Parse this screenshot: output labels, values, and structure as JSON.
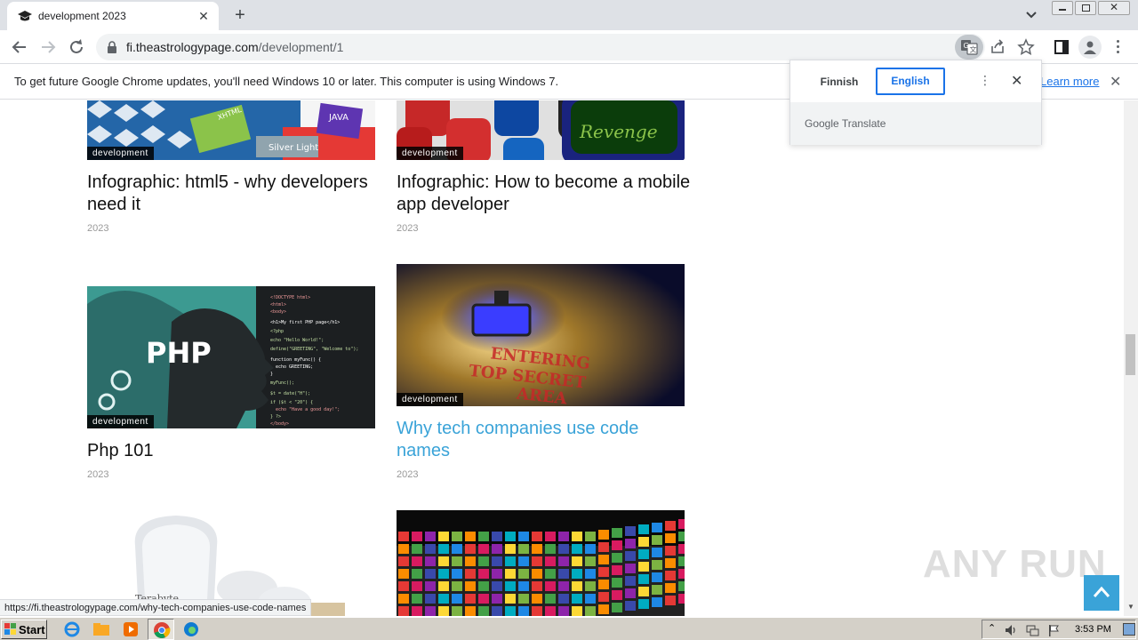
{
  "browser": {
    "tab_title": "development 2023",
    "url_host": "fi.theastrologypage.com",
    "url_path": "/development/1"
  },
  "infobar": {
    "message": "To get future Google Chrome updates, you'll need Windows 10 or later. This computer is using Windows 7.",
    "learn_more": "Learn more"
  },
  "translate_popup": {
    "source_lang": "Finnish",
    "target_lang": "English",
    "footer": "Google Translate"
  },
  "articles": [
    {
      "tag": "development",
      "title": "Infographic: html5 - why developers need it",
      "year": "2023",
      "image_text": [
        "XHTML",
        "JAVA",
        "Silver Light"
      ]
    },
    {
      "tag": "development",
      "title": "Infographic: How to become a mobile app developer",
      "year": "2023",
      "image_text": [
        "Revenge"
      ]
    },
    {
      "tag": "development",
      "title": "Php 101",
      "year": "2023",
      "image_text": [
        "PHP"
      ]
    },
    {
      "tag": "development",
      "title": "Why tech companies use code names",
      "year": "2023",
      "image_text": [
        "ENTERING",
        "TOP SECRET",
        "AREA"
      ]
    },
    {
      "image_text": [
        "Terabyte"
      ]
    }
  ],
  "status_url": "https://fi.theastrologypage.com/why-tech-companies-use-code-names",
  "watermark": "ANY RUN",
  "taskbar": {
    "start": "Start",
    "clock": "3:53 PM"
  },
  "colors": {
    "link": "#3aa3d8",
    "tab_strip": "#dee1e6",
    "accent": "#1a73e8"
  }
}
